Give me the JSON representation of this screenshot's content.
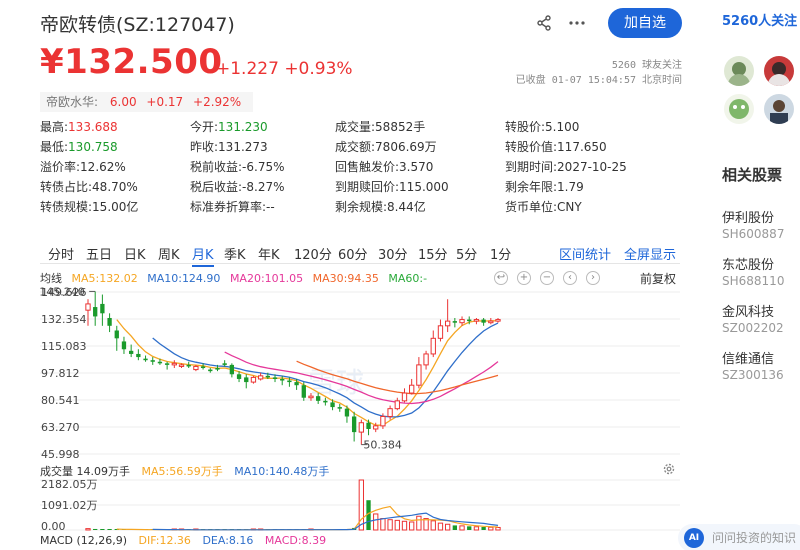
{
  "header": {
    "title": "帝欧转债(SZ:127047)",
    "follow_label": "加自选",
    "share_icon": "share-icon",
    "more_icon": "more-icon"
  },
  "quote": {
    "price": "¥132.500",
    "change": "+1.227 +0.93%",
    "followers": "5260 球友关注",
    "status": "已收盘 01-07 15:04:57 北京时间"
  },
  "underlying": {
    "label": "帝欧水华:",
    "price": "6.00",
    "change": "+0.17",
    "pct": "+2.92%"
  },
  "stats": [
    [
      {
        "k": "最高:",
        "v": "133.688",
        "c": "red"
      },
      {
        "k": "今开:",
        "v": "131.230",
        "c": "green"
      },
      {
        "k": "成交量:",
        "v": "58852手",
        "c": ""
      },
      {
        "k": "转股价:",
        "v": "5.100",
        "c": ""
      }
    ],
    [
      {
        "k": "最低:",
        "v": "130.758",
        "c": "green"
      },
      {
        "k": "昨收:",
        "v": "131.273",
        "c": ""
      },
      {
        "k": "成交额:",
        "v": "7806.69万",
        "c": ""
      },
      {
        "k": "转股价值:",
        "v": "117.650",
        "c": ""
      }
    ],
    [
      {
        "k": "溢价率:",
        "v": "12.62%",
        "c": ""
      },
      {
        "k": "税前收益:",
        "v": "-6.75%",
        "c": ""
      },
      {
        "k": "回售触发价:",
        "v": "3.570",
        "c": ""
      },
      {
        "k": "到期时间:",
        "v": "2027-10-25",
        "c": ""
      }
    ],
    [
      {
        "k": "转债占比:",
        "v": "48.70%",
        "c": ""
      },
      {
        "k": "税后收益:",
        "v": "-8.27%",
        "c": ""
      },
      {
        "k": "到期赎回价:",
        "v": "115.000",
        "c": ""
      },
      {
        "k": "剩余年限:",
        "v": "1.79",
        "c": ""
      }
    ],
    [
      {
        "k": "转债规模:",
        "v": "15.00亿",
        "c": ""
      },
      {
        "k": "标准券折算率:",
        "v": "--",
        "c": ""
      },
      {
        "k": "剩余规模:",
        "v": "8.44亿",
        "c": ""
      },
      {
        "k": "货币单位:",
        "v": "CNY",
        "c": ""
      }
    ]
  ],
  "tabs": [
    "分时",
    "五日",
    "日K",
    "周K",
    "月K",
    "季K",
    "年K",
    "120分",
    "60分",
    "30分",
    "15分",
    "5分",
    "1分"
  ],
  "active_tab": "月K",
  "tabs_right": [
    "区间统计",
    "全屏显示"
  ],
  "ma": {
    "label": "均线",
    "ma5": "MA5:132.02",
    "ma10": "MA10:124.90",
    "ma20": "MA20:101.05",
    "ma30": "MA30:94.35",
    "ma60": "MA60:-",
    "restore_label": "前复权"
  },
  "colors": {
    "red": "#eb3333",
    "green": "#1a9a2b",
    "blue": "#1e66d9",
    "ma5": "#f5a623",
    "ma10": "#2f6fca",
    "ma20": "#e5389a",
    "ma30": "#f0662b",
    "ma60": "#2aaa3a"
  },
  "y_ticks": [
    "149.626",
    "132.354",
    "115.083",
    "97.812",
    "80.541",
    "63.270",
    "45.998"
  ],
  "annotations": {
    "high": "145.240",
    "low": "50.384"
  },
  "volume": {
    "label": "成交量 14.09万手",
    "ma5": "MA5:56.59万手",
    "ma10": "MA10:140.48万手",
    "ticks": [
      "2182.05万",
      "1091.02万",
      "0.00"
    ]
  },
  "macd": {
    "label": "MACD (12,26,9)",
    "dif": "DIF:12.36",
    "dea": "DEA:8.16",
    "macd": "MACD:8.39"
  },
  "watermark": "雪球",
  "sidebar": {
    "followers": "5260人关注",
    "related_title": "相关股票",
    "related": [
      {
        "name": "伊利股份",
        "code": "SH600887"
      },
      {
        "name": "东芯股份",
        "code": "SH688110"
      },
      {
        "name": "金风科技",
        "code": "SZ002202"
      },
      {
        "name": "信维通信",
        "code": "SZ300136"
      }
    ],
    "ask_placeholder": "问问投资的知识",
    "ask_icon_label": "AI"
  },
  "chart_data": {
    "type": "candlestick",
    "y_range": [
      45.998,
      149.626
    ],
    "candles": [
      [
        138,
        142,
        128,
        145
      ],
      [
        140,
        134,
        128,
        150
      ],
      [
        142,
        136,
        128,
        148
      ],
      [
        133,
        128,
        124,
        136
      ],
      [
        125,
        120,
        112,
        128
      ],
      [
        118,
        113,
        110,
        121
      ],
      [
        112,
        110,
        108,
        116
      ],
      [
        110,
        108,
        106,
        113
      ],
      [
        107,
        106,
        105,
        109
      ],
      [
        106,
        105,
        103,
        108
      ],
      [
        105,
        104,
        103,
        107
      ],
      [
        104,
        103,
        100,
        105
      ],
      [
        103,
        104,
        101,
        106
      ],
      [
        102,
        103,
        101,
        104
      ],
      [
        103,
        102,
        101,
        105
      ],
      [
        100,
        102,
        99,
        103
      ],
      [
        102,
        101,
        100,
        104
      ],
      [
        100,
        99,
        98,
        101
      ],
      [
        101,
        100,
        99,
        103
      ],
      [
        104,
        103,
        102,
        106
      ],
      [
        103,
        97,
        95,
        104
      ],
      [
        97,
        94,
        92,
        99
      ],
      [
        95,
        92,
        88,
        97
      ],
      [
        92,
        95,
        91,
        96
      ],
      [
        94,
        96,
        93,
        98
      ],
      [
        96,
        95,
        94,
        98
      ],
      [
        95,
        94,
        92,
        97
      ],
      [
        94,
        93,
        90,
        96
      ],
      [
        93,
        92,
        89,
        95
      ],
      [
        92,
        90,
        87,
        94
      ],
      [
        90,
        82,
        80,
        92
      ],
      [
        82,
        83,
        80,
        85
      ],
      [
        83,
        80,
        78,
        85
      ],
      [
        80,
        79,
        77,
        82
      ],
      [
        79,
        76,
        74,
        81
      ],
      [
        76,
        75,
        73,
        78
      ],
      [
        75,
        70,
        66,
        77
      ],
      [
        70,
        60,
        54,
        73
      ],
      [
        60,
        66,
        52,
        68
      ],
      [
        66,
        62,
        58,
        68
      ],
      [
        62,
        64,
        60,
        66
      ],
      [
        64,
        70,
        62,
        72
      ],
      [
        70,
        75,
        68,
        77
      ],
      [
        75,
        80,
        74,
        82
      ],
      [
        80,
        85,
        79,
        88
      ],
      [
        85,
        90,
        84,
        94
      ],
      [
        90,
        103,
        88,
        108
      ],
      [
        103,
        110,
        100,
        112
      ],
      [
        110,
        120,
        108,
        125
      ],
      [
        120,
        128,
        118,
        132
      ],
      [
        128,
        131,
        124,
        145
      ],
      [
        131,
        130,
        127,
        133
      ],
      [
        130,
        132,
        128,
        134
      ],
      [
        132,
        131,
        129,
        134
      ],
      [
        131,
        132,
        129,
        133
      ],
      [
        132,
        130,
        128,
        133
      ],
      [
        130,
        131,
        129,
        133
      ],
      [
        131,
        132,
        130,
        133
      ]
    ],
    "volume": [
      60,
      45,
      40,
      30,
      25,
      20,
      18,
      15,
      12,
      10,
      10,
      9,
      8,
      8,
      9,
      8,
      8,
      7,
      8,
      9,
      12,
      14,
      15,
      13,
      12,
      11,
      10,
      12,
      14,
      16,
      20,
      18,
      17,
      16,
      18,
      20,
      30,
      90,
      2182,
      1300,
      700,
      500,
      450,
      420,
      380,
      350,
      600,
      500,
      400,
      300,
      250,
      200,
      180,
      160,
      140,
      130,
      120,
      110
    ]
  }
}
